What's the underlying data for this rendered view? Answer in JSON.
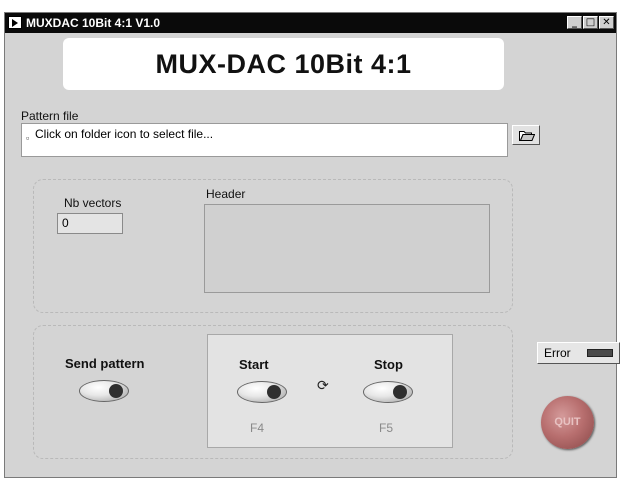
{
  "window": {
    "title": "MUXDAC 10Bit 4:1 V1.0",
    "minimize": "_",
    "maximize": "□",
    "close": "✕"
  },
  "banner": {
    "title": "MUX-DAC 10Bit 4:1"
  },
  "pattern_file": {
    "label": "Pattern file",
    "value": "Click on folder icon to select file...",
    "browse_icon": "folder-open-icon"
  },
  "info": {
    "nb_vectors_label": "Nb vectors",
    "nb_vectors_value": "0",
    "header_label": "Header"
  },
  "controls": {
    "send_pattern_label": "Send pattern",
    "start_label": "Start",
    "stop_label": "Stop",
    "start_key": "F4",
    "stop_key": "F5",
    "loop_icon": "⟳"
  },
  "error": {
    "label": "Error"
  },
  "quit": {
    "label": "QUIT"
  }
}
